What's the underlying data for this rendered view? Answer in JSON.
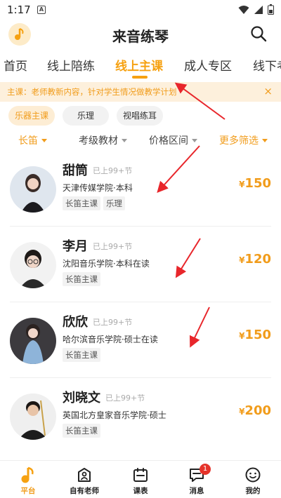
{
  "status_bar": {
    "time": "1:17",
    "indicator": "A"
  },
  "header": {
    "title": "来音练琴",
    "logo_icon": "music-note-icon",
    "search_icon": "search-icon"
  },
  "nav_tabs": [
    {
      "label": "首页",
      "active": false
    },
    {
      "label": "线上陪练",
      "active": false
    },
    {
      "label": "线上主课",
      "active": true
    },
    {
      "label": "成人专区",
      "active": false
    },
    {
      "label": "线下考",
      "active": false
    }
  ],
  "notice": {
    "text": "主课：老师教新内容，针对学生情况做教学计划",
    "close": "×"
  },
  "chips": [
    {
      "label": "乐器主课",
      "active": true
    },
    {
      "label": "乐理",
      "active": false
    },
    {
      "label": "视唱练耳",
      "active": false
    }
  ],
  "filters": [
    {
      "label": "长笛",
      "active": true
    },
    {
      "label": "考级教材",
      "active": false
    },
    {
      "label": "价格区间",
      "active": false
    },
    {
      "label": "更多筛选",
      "active": true
    }
  ],
  "teachers": [
    {
      "name": "甜筒",
      "classes": "已上99+节",
      "school": "天津传媒学院·本科",
      "tags": [
        "长笛主课",
        "乐理"
      ],
      "price": "150",
      "currency": "¥"
    },
    {
      "name": "李月",
      "classes": "已上99+节",
      "school": "沈阳音乐学院·本科在读",
      "tags": [
        "长笛主课"
      ],
      "price": "120",
      "currency": "¥"
    },
    {
      "name": "欣欣",
      "classes": "已上99+节",
      "school": "哈尔滨音乐学院·硕士在读",
      "tags": [
        "长笛主课"
      ],
      "price": "150",
      "currency": "¥"
    },
    {
      "name": "刘晓文",
      "classes": "已上99+节",
      "school": "英国北方皇家音乐学院·硕士",
      "tags": [
        "长笛主课"
      ],
      "price": "200",
      "currency": "¥"
    }
  ],
  "bottom_nav": [
    {
      "label": "平台",
      "icon": "music-note-icon",
      "active": true
    },
    {
      "label": "自有老师",
      "icon": "teacher-icon",
      "active": false
    },
    {
      "label": "课表",
      "icon": "calendar-icon",
      "active": false
    },
    {
      "label": "消息",
      "icon": "message-icon",
      "active": false,
      "badge": "1"
    },
    {
      "label": "我的",
      "icon": "smiley-icon",
      "active": false
    }
  ],
  "colors": {
    "accent": "#f6a111",
    "badge": "#e5332a",
    "arrow": "#e8262b"
  }
}
